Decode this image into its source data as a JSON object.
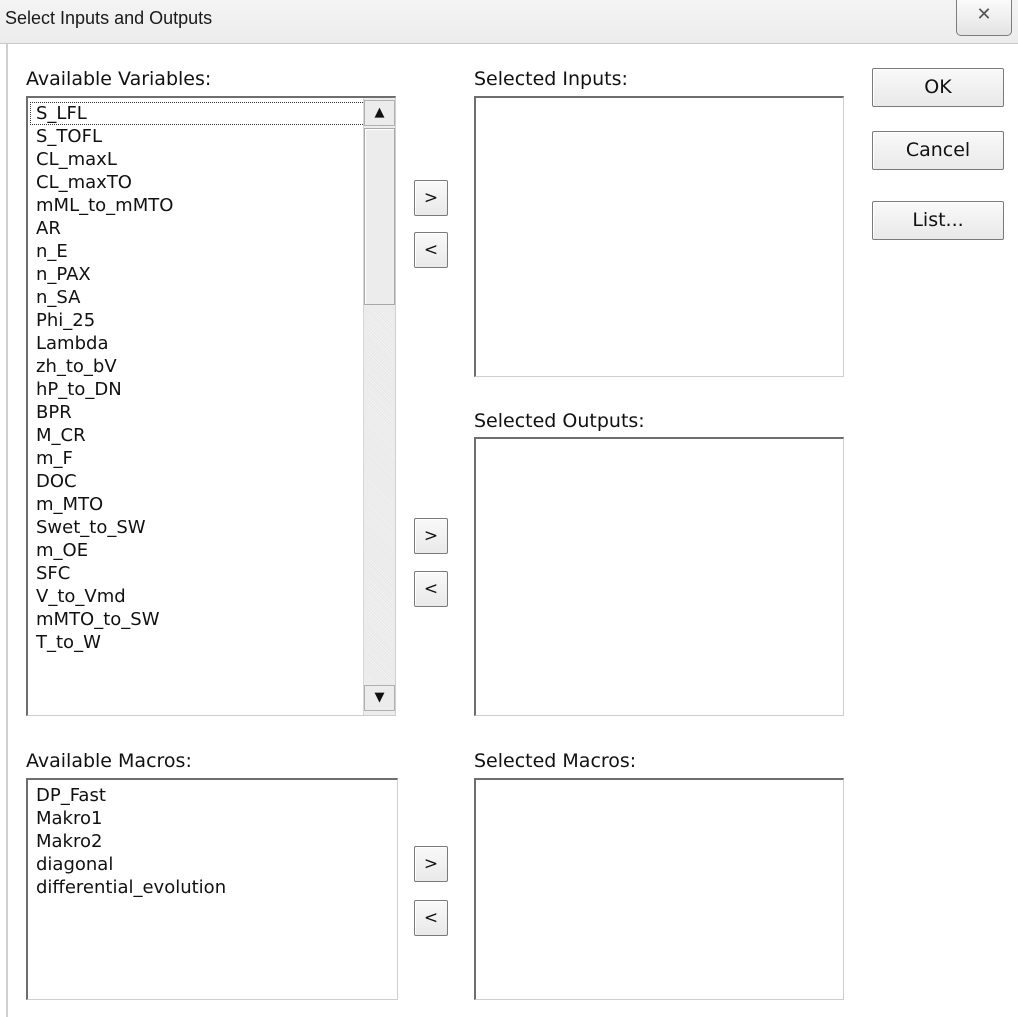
{
  "window": {
    "title": "Select Inputs and Outputs",
    "close_glyph": "✕"
  },
  "labels": {
    "available_variables": "Available Variables:",
    "selected_inputs": "Selected Inputs:",
    "selected_outputs": "Selected Outputs:",
    "available_macros": "Available Macros:",
    "selected_macros": "Selected Macros:"
  },
  "available_variables": [
    "S_LFL",
    "S_TOFL",
    "CL_maxL",
    "CL_maxTO",
    "mML_to_mMTO",
    "AR",
    "n_E",
    "n_PAX",
    "n_SA",
    "Phi_25",
    "Lambda",
    "zh_to_bV",
    "hP_to_DN",
    "BPR",
    "M_CR",
    "m_F",
    "DOC",
    "m_MTO",
    "Swet_to_SW",
    "m_OE",
    "SFC",
    "V_to_Vmd",
    "mMTO_to_SW",
    "T_to_W"
  ],
  "available_macros": [
    "DP_Fast",
    "Makro1",
    "Makro2",
    "diagonal",
    "differential_evolution"
  ],
  "selected_inputs": [],
  "selected_outputs": [],
  "selected_macros": [],
  "buttons": {
    "ok": "OK",
    "cancel": "Cancel",
    "list": "List...",
    "add": ">",
    "remove": "<"
  },
  "scrollbar": {
    "up_glyph": "▲",
    "down_glyph": "▼"
  },
  "icons": {
    "close": "close-icon",
    "scroll_up": "arrow-up-icon",
    "scroll_down": "arrow-down-icon"
  }
}
